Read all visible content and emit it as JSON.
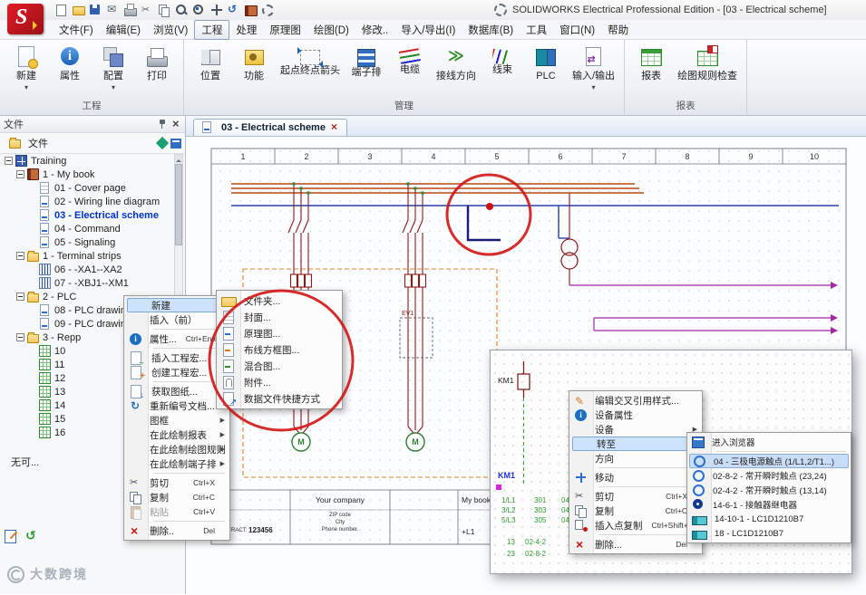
{
  "titlebar": {
    "title": "SOLIDWORKS Electrical Professional Edition - [03 - Electrical scheme]",
    "icons": [
      {
        "icon": "tb-page"
      },
      {
        "icon": "tb-folder"
      },
      {
        "icon": "tb-save"
      },
      {
        "icon": "tb-mail"
      },
      {
        "icon": "tb-print"
      },
      {
        "icon": "tb-cut"
      },
      {
        "icon": "tb-copy"
      },
      {
        "icon": "tb-zoom"
      },
      {
        "icon": "tb-zoomfit"
      },
      {
        "icon": "tb-pan"
      },
      {
        "icon": "tb-undo"
      },
      {
        "icon": "tb-book"
      },
      {
        "icon": "tb-gear"
      }
    ]
  },
  "menubar": {
    "items": [
      {
        "label": "文件(F)"
      },
      {
        "label": "编辑(E)"
      },
      {
        "label": "浏览(V)"
      },
      {
        "label": "工程",
        "active": true
      },
      {
        "label": "处理"
      },
      {
        "label": "原理图"
      },
      {
        "label": "绘图(D)"
      },
      {
        "label": "修改.."
      },
      {
        "label": "导入/导出(I)"
      },
      {
        "label": "数据库(B)"
      },
      {
        "label": "工具"
      },
      {
        "label": "窗口(N)"
      },
      {
        "label": "帮助"
      }
    ]
  },
  "ribbon": {
    "groups": [
      {
        "label": "工程",
        "buttons": [
          {
            "label": "新建",
            "icon": "new",
            "arrow": true
          },
          {
            "label": "属性",
            "icon": "info"
          },
          {
            "label": "配置",
            "icon": "config",
            "arrow": true
          },
          {
            "label": "打印",
            "icon": "print"
          }
        ]
      },
      {
        "label": "管理",
        "buttons": [
          {
            "label": "位置",
            "icon": "location"
          },
          {
            "label": "功能",
            "icon": "function"
          },
          {
            "label": "起点终点箭头",
            "icon": "arrows"
          },
          {
            "label": "端子排",
            "icon": "terminal"
          },
          {
            "label": "电缆",
            "icon": "cable"
          },
          {
            "label": "接线方向",
            "icon": "direction"
          },
          {
            "label": "线束",
            "icon": "harness"
          },
          {
            "label": "PLC",
            "icon": "plc"
          },
          {
            "label": "输入/输出",
            "icon": "io",
            "arrow": true
          }
        ]
      },
      {
        "label": "报表",
        "buttons": [
          {
            "label": "报表",
            "icon": "report"
          },
          {
            "label": "绘图规则检查",
            "icon": "drc"
          }
        ]
      }
    ]
  },
  "sidebar": {
    "header": "文件",
    "tab": "文件",
    "empty_text": "无可...",
    "tree": [
      {
        "level": 0,
        "icon": "project",
        "label": "Training",
        "exp": true
      },
      {
        "level": 1,
        "icon": "book",
        "label": "1 - My book",
        "exp": true
      },
      {
        "level": 2,
        "icon": "page-cover",
        "label": "01 - Cover page"
      },
      {
        "level": 2,
        "icon": "page-scheme",
        "label": "02 - Wiring line diagram"
      },
      {
        "level": 2,
        "icon": "page-scheme",
        "label": "03 - Electrical scheme",
        "selected": true
      },
      {
        "level": 2,
        "icon": "page-scheme",
        "label": "04 - Command"
      },
      {
        "level": 2,
        "icon": "page-scheme",
        "label": "05 - Signaling"
      },
      {
        "level": 1,
        "icon": "folder",
        "label": "1 - Terminal strips",
        "exp": true
      },
      {
        "level": 2,
        "icon": "terminal",
        "label": "06 - -XA1--XA2"
      },
      {
        "level": 2,
        "icon": "terminal",
        "label": "07 - -XBJ1--XM1"
      },
      {
        "level": 1,
        "icon": "folder",
        "label": "2 - PLC",
        "exp": true
      },
      {
        "level": 2,
        "icon": "page-scheme",
        "label": "08 - PLC drawing"
      },
      {
        "level": 2,
        "icon": "page-scheme",
        "label": "09 - PLC drawing"
      },
      {
        "level": 1,
        "icon": "folder",
        "label": "3 - Repp",
        "exp": true
      },
      {
        "level": 2,
        "icon": "table",
        "label": "10"
      },
      {
        "level": 2,
        "icon": "table",
        "label": "11"
      },
      {
        "level": 2,
        "icon": "table",
        "label": "12"
      },
      {
        "level": 2,
        "icon": "table",
        "label": "13"
      },
      {
        "level": 2,
        "icon": "table",
        "label": "14"
      },
      {
        "level": 2,
        "icon": "table",
        "label": "15"
      },
      {
        "level": 2,
        "icon": "table",
        "label": "16"
      }
    ]
  },
  "doc": {
    "tab": "03 - Electrical scheme"
  },
  "schematic": {
    "columns": [
      "1",
      "2",
      "3",
      "4",
      "5",
      "6",
      "7",
      "8",
      "9",
      "10"
    ],
    "motor_label": "M",
    "device_label": "EV1",
    "title_block": {
      "company": "Your company",
      "zip": "ZIP code",
      "city": "City",
      "phone": "Phone number.",
      "contract_label": "CONTRACT:",
      "contract": "123456",
      "book": "My book",
      "location": "+L1"
    }
  },
  "context_menu": {
    "items": [
      {
        "label": "新建",
        "arrow": true,
        "hl": true
      },
      {
        "label": "插入（前）",
        "arrow": true
      },
      {
        "type": "sep"
      },
      {
        "label": "属性...",
        "icon": "info",
        "shortcut": "Ctrl+Enter"
      },
      {
        "type": "sep"
      },
      {
        "label": "插入工程宏...",
        "icon": "macro-insert"
      },
      {
        "label": "创建工程宏...",
        "icon": "macro-create"
      },
      {
        "type": "sep"
      },
      {
        "label": "获取图纸...",
        "icon": "get-sheet"
      },
      {
        "label": "重新编号文档...",
        "icon": "renumber"
      },
      {
        "label": "图框",
        "arrow": true
      },
      {
        "label": "在此绘制报表",
        "arrow": true
      },
      {
        "label": "在此绘制绘图规则",
        "arrow": true
      },
      {
        "label": "在此绘制端子排",
        "arrow": true
      },
      {
        "type": "sep"
      },
      {
        "label": "剪切",
        "icon": "cut",
        "shortcut": "Ctrl+X"
      },
      {
        "label": "复制",
        "icon": "copy",
        "shortcut": "Ctrl+C"
      },
      {
        "label": "粘贴",
        "icon": "paste",
        "shortcut": "Ctrl+V",
        "disabled": true
      },
      {
        "type": "sep"
      },
      {
        "label": "删除..",
        "icon": "delete",
        "shortcut": "Del"
      }
    ]
  },
  "new_submenu": {
    "items": [
      {
        "label": "文件夹...",
        "icon": "folder"
      },
      {
        "label": "封面...",
        "icon": "page-cover"
      },
      {
        "label": "原理图...",
        "icon": "page-scheme"
      },
      {
        "label": "布线方框图...",
        "icon": "page-wiring"
      },
      {
        "label": "混合图...",
        "icon": "page-mixed"
      },
      {
        "label": "附件...",
        "icon": "attachment"
      },
      {
        "label": "数据文件快捷方式",
        "icon": "shortcut"
      }
    ]
  },
  "popup": {
    "coil_label": "KM1",
    "ref_label": "KM1",
    "crossref_rows": [
      [
        "1/L1",
        "301",
        "04"
      ],
      [
        "3/L2",
        "303",
        "04"
      ],
      [
        "5/L3",
        "305",
        "04"
      ]
    ],
    "aux_rows": [
      [
        "13",
        "02-4-2"
      ],
      [
        "23",
        "02-8-2"
      ]
    ],
    "menu": {
      "items": [
        {
          "label": "编辑交叉引用样式...",
          "icon": "edit-ref"
        },
        {
          "label": "设备属性",
          "icon": "info"
        },
        {
          "label": "设备",
          "arrow": true
        },
        {
          "label": "转至",
          "arrow": true,
          "hl": true
        },
        {
          "label": "方向",
          "arrow": true
        },
        {
          "type": "sep"
        },
        {
          "label": "移动",
          "icon": "move"
        },
        {
          "type": "sep"
        },
        {
          "label": "剪切",
          "icon": "cut",
          "shortcut": "Ctrl+X"
        },
        {
          "label": "复制",
          "icon": "copy",
          "shortcut": "Ctrl+C"
        },
        {
          "label": "插入点复制",
          "icon": "copy-point",
          "shortcut": "Ctrl+Shift+C"
        },
        {
          "type": "sep"
        },
        {
          "label": "删除...",
          "icon": "delete",
          "shortcut": "Del"
        }
      ]
    },
    "goto_submenu": {
      "items": [
        {
          "label": "进入浏览器",
          "icon": "browser"
        },
        {
          "type": "sep"
        },
        {
          "label": "04 - 三极电源触点 (1/L1,2/T1...)",
          "icon": "contact",
          "selected": true
        },
        {
          "label": "02-8-2 - 常开瞬时触点 (23,24)",
          "icon": "contact"
        },
        {
          "label": "02-4-2 - 常开瞬时触点 (13,14)",
          "icon": "contact"
        },
        {
          "label": "14-6-1 - 接触器继电器",
          "icon": "relay"
        },
        {
          "label": "14-10-1 - LC1D1210B7",
          "icon": "part"
        },
        {
          "label": "18 - LC1D1210B7",
          "icon": "part"
        }
      ]
    }
  },
  "watermark": {
    "text": "大数跨境"
  },
  "colors": {
    "annotation": "#d11515",
    "selected_text": "#0033cc",
    "highlight_bg": "#cde3fb",
    "phase_wire": "#b54a12",
    "neutral_wire": "#2a3fb0",
    "control_wire": "#a22aa2"
  }
}
